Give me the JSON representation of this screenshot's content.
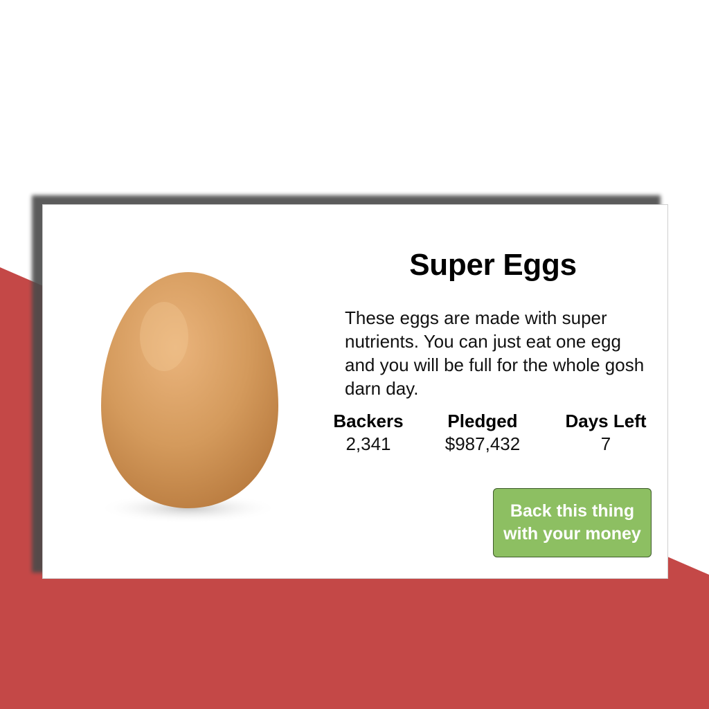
{
  "colors": {
    "background_accent": "#c44847",
    "card": "#ffffff",
    "button": "#8dbf62",
    "egg": "#d49a5c"
  },
  "product": {
    "title": "Super Eggs",
    "description": "These eggs are made with super nutrients. You can just eat one egg and you will be full for the whole gosh darn day.",
    "image_icon": "egg-image"
  },
  "stats": {
    "backers": {
      "label": "Backers",
      "value": "2,341"
    },
    "pledged": {
      "label": "Pledged",
      "value": "$987,432"
    },
    "days_left": {
      "label": "Days Left",
      "value": "7"
    }
  },
  "cta": {
    "label_line1": "Back this thing",
    "label_line2": "with your money"
  }
}
